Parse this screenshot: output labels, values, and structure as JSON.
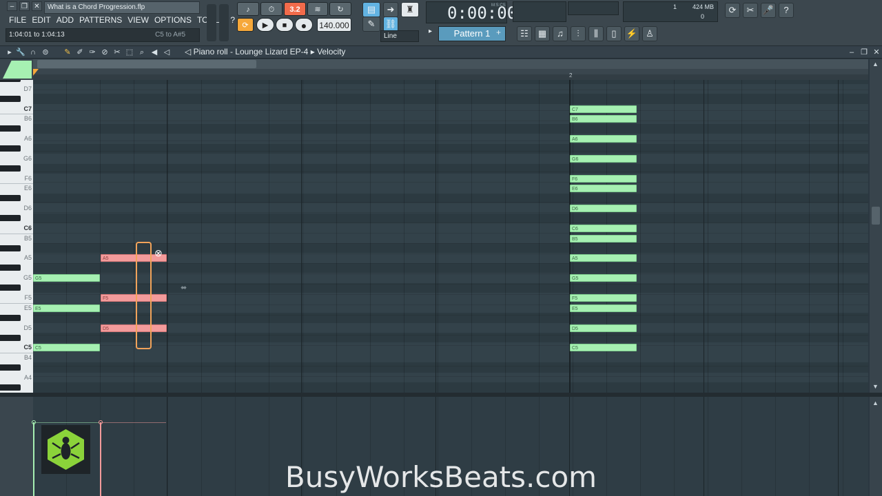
{
  "app": {
    "project_title": "What is a Chord Progression.flp",
    "hint_text": "1:04:01 to 1:04:13",
    "hint_right": "C5 to A#5",
    "menu": [
      "FILE",
      "EDIT",
      "ADD",
      "PATTERNS",
      "VIEW",
      "OPTIONS",
      "TOOLS",
      "?"
    ]
  },
  "transport": {
    "time_display": "0:00:00",
    "time_unit": "M:S:CS",
    "tempo": "140.000",
    "snap_mode": "Line",
    "pattern_name": "Pattern 1",
    "step_display": "3.2",
    "cpu_value": "1",
    "memory": "424 MB",
    "voices": "0"
  },
  "piano_roll": {
    "breadcrumb": [
      "Piano roll",
      "Lounge Lizard EP-4",
      "Velocity"
    ],
    "bar_number": "2",
    "key_labels": [
      "D7",
      "C7",
      "B6",
      "A6",
      "G6",
      "F6",
      "E6",
      "D6",
      "C6",
      "B5",
      "A5",
      "G5",
      "F5",
      "E5",
      "D5",
      "C5",
      "B4",
      "A4"
    ]
  },
  "notes": {
    "chord1": [
      {
        "label": "G5",
        "color": "green"
      },
      {
        "label": "E5",
        "color": "green"
      },
      {
        "label": "C5",
        "color": "green"
      }
    ],
    "chord2": [
      {
        "label": "A5",
        "color": "red"
      },
      {
        "label": "F5",
        "color": "red"
      },
      {
        "label": "D5",
        "color": "red"
      }
    ],
    "chord3": [
      {
        "label": "C7"
      },
      {
        "label": "B6"
      },
      {
        "label": "A6"
      },
      {
        "label": "G6"
      },
      {
        "label": "F6"
      },
      {
        "label": "E6"
      },
      {
        "label": "D6"
      },
      {
        "label": "C6"
      },
      {
        "label": "B5"
      },
      {
        "label": "A5"
      },
      {
        "label": "G5"
      },
      {
        "label": "F5"
      },
      {
        "label": "E5"
      },
      {
        "label": "D5"
      },
      {
        "label": "C5"
      }
    ]
  },
  "watermark": "BusyWorksBeats.com",
  "colors": {
    "note_green": "#a6f0b2",
    "note_red": "#f39b9b",
    "pattern_blue": "#5a9bbd",
    "selection_orange": "#f2a35a"
  }
}
